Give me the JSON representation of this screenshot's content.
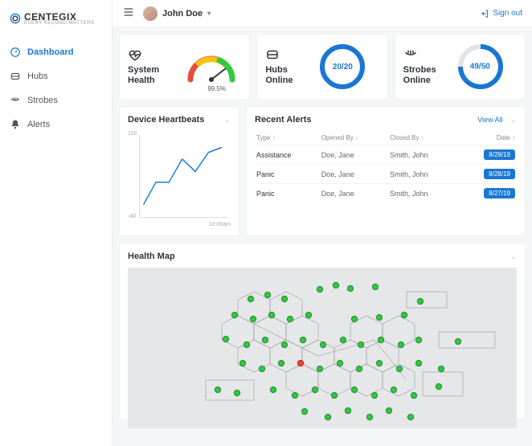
{
  "brand": {
    "name": "CENTEGIX",
    "tagline": "EVERY SECOND MATTERS"
  },
  "topbar": {
    "user_name": "John Doe",
    "signout_label": "Sign out"
  },
  "nav": {
    "items": [
      {
        "label": "Dashboard"
      },
      {
        "label": "Hubs"
      },
      {
        "label": "Strobes"
      },
      {
        "label": "Alerts"
      }
    ]
  },
  "stats": {
    "health": {
      "title": "System Health",
      "value": "99.5%"
    },
    "hubs": {
      "title": "Hubs Online",
      "value": "20/20"
    },
    "strobes": {
      "title": "Strobes Online",
      "value": "49/50"
    }
  },
  "heartbeats": {
    "title": "Device Heartbeats",
    "y_max": "100",
    "y_min": "-40",
    "x_label": "10:00am"
  },
  "alerts": {
    "title": "Recent Alerts",
    "view_all": "View All",
    "cols": {
      "type": "Type",
      "opened": "Opened By",
      "closed": "Closed By",
      "date": "Date"
    },
    "rows": [
      {
        "type": "Assistance",
        "opened": "Doe, Jane",
        "closed": "Smith, John",
        "date": "8/29/19"
      },
      {
        "type": "Panic",
        "opened": "Doe, Jane",
        "closed": "Smith, John",
        "date": "8/28/19"
      },
      {
        "type": "Panic",
        "opened": "Doe, Jane",
        "closed": "Smith, John",
        "date": "8/27/19"
      }
    ]
  },
  "health_map": {
    "title": "Health Map"
  },
  "chart_data": {
    "type": "line",
    "title": "Device Heartbeats",
    "xlabel": "",
    "ylabel": "",
    "ylim": [
      -40,
      100
    ],
    "x_ticks": [
      "10:00am"
    ],
    "series": [
      {
        "name": "heartbeats",
        "values": [
          -20,
          20,
          20,
          58,
          38,
          70,
          78
        ]
      }
    ]
  }
}
